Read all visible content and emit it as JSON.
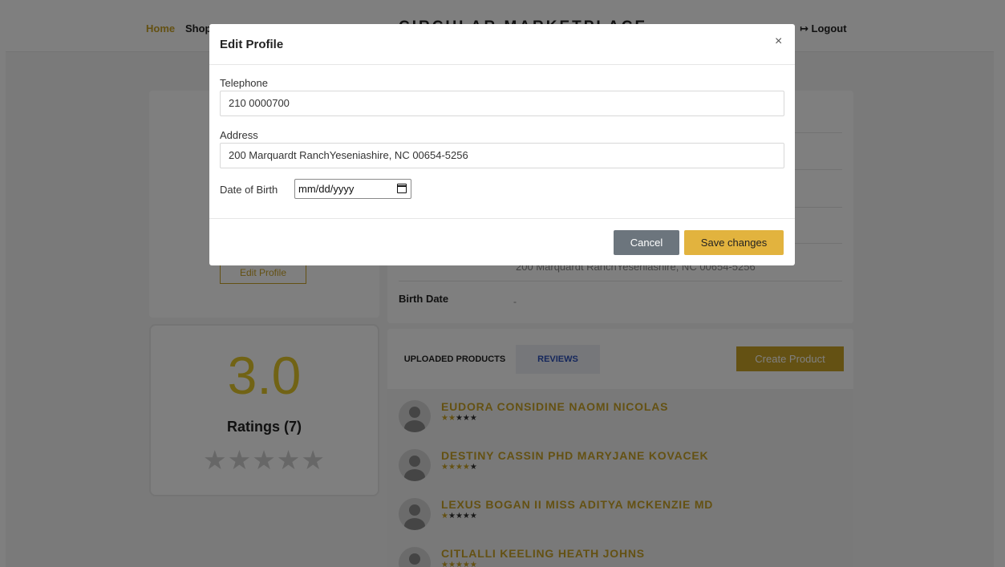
{
  "nav": {
    "home": "Home",
    "shop": "Shop",
    "brand": "CIRCULAR MARKETPLACE",
    "profile_partial": "e",
    "logout_icon": "logout-icon",
    "logout": "Logout"
  },
  "profile": {
    "edit_button": "Edit Profile"
  },
  "info": {
    "address_value": "200 Marquardt RanchYeseniashire, NC 00654-5256",
    "birth_label": "Birth Date",
    "birth_value": "-"
  },
  "rating": {
    "value": "3.0",
    "count_label": "Ratings (7)",
    "stars": "★★★★★"
  },
  "products": {
    "tabs": [
      "UPLOADED PRODUCTS",
      "REVIEWS"
    ],
    "create_button": "Create Product",
    "items": [
      {
        "name": "EUDORA CONSIDINE NAOMI NICOLAS",
        "rating": 2
      },
      {
        "name": "DESTINY CASSIN PHD MARYJANE KOVACEK",
        "rating": 4
      },
      {
        "name": "LEXUS BOGAN II MISS ADITYA MCKENZIE MD",
        "rating": 1
      },
      {
        "name": "CITLALLI KEELING HEATH JOHNS",
        "rating": 5
      }
    ]
  },
  "modal": {
    "title": "Edit Profile",
    "close": "×",
    "telephone_label": "Telephone",
    "telephone_value": "210 0000700",
    "address_label": "Address",
    "address_value": "200 Marquardt RanchYeseniashire, NC 00654-5256",
    "dob_label": "Date of Birth",
    "dob_placeholder": "mm/dd/yyyy",
    "cancel": "Cancel",
    "save": "Save changes"
  },
  "colors": {
    "accent": "#c9a227",
    "save_button": "#e2b33e",
    "cancel_button": "#6c757d",
    "rating_value": "#e2c72a"
  }
}
